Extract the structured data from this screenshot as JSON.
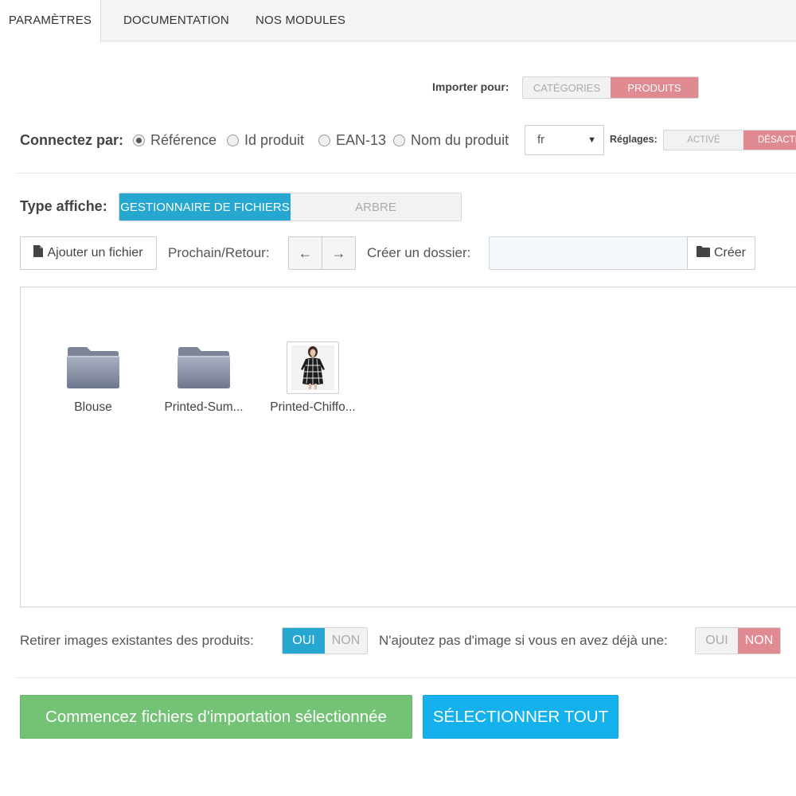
{
  "tabs": [
    {
      "label": "Paramètres",
      "active": true
    },
    {
      "label": "Documentation",
      "active": false
    },
    {
      "label": "Nos modules",
      "active": false
    }
  ],
  "import": {
    "label": "Importer pour:",
    "options": [
      "Catégories",
      "Produits"
    ],
    "selected": "Produits"
  },
  "connect": {
    "label": "Connectez par:",
    "options": [
      "Référence",
      "Id produit",
      "EAN-13",
      "Nom du produit"
    ],
    "selected": "Référence"
  },
  "language": {
    "value": "fr"
  },
  "reglages": {
    "label": "Réglages:",
    "options": [
      "Activé",
      "Désacti"
    ],
    "selected": "Désacti"
  },
  "display_type": {
    "label": "Type affiche:",
    "options": [
      "Gestionnaire de fichiers",
      "Arbre"
    ],
    "selected": "Gestionnaire de fichiers"
  },
  "toolbar": {
    "add_file": "Ajouter un fichier",
    "nav_label": "Prochain/Retour:",
    "prev_icon": "←",
    "next_icon": "→",
    "folder_label": "Créer un dossier:",
    "folder_value": "",
    "create": "Créer"
  },
  "files": [
    {
      "name": "Blouse",
      "type": "folder",
      "icon": "folder-icon"
    },
    {
      "name": "Printed-Sum...",
      "type": "folder",
      "icon": "folder-icon"
    },
    {
      "name": "Printed-Chiffo...",
      "type": "image",
      "icon": "dress-image-thumbnail"
    }
  ],
  "remove_images": {
    "label": "Retirer images existantes des produits:",
    "options": [
      "Oui",
      "Non"
    ],
    "selected": "Oui"
  },
  "no_add_image": {
    "label": "N'ajoutez pas d'image si vous en avez déjà une:",
    "options": [
      "Oui",
      "Non"
    ],
    "selected": "Non"
  },
  "actions": {
    "start_import": "Commencez fichiers d'importation sélectionnée",
    "select_all": "Sélectionner tout"
  },
  "colors": {
    "pink": "#e08a92",
    "blue": "#25a7cf",
    "green": "#73c275",
    "cyan": "#14b1ec"
  }
}
